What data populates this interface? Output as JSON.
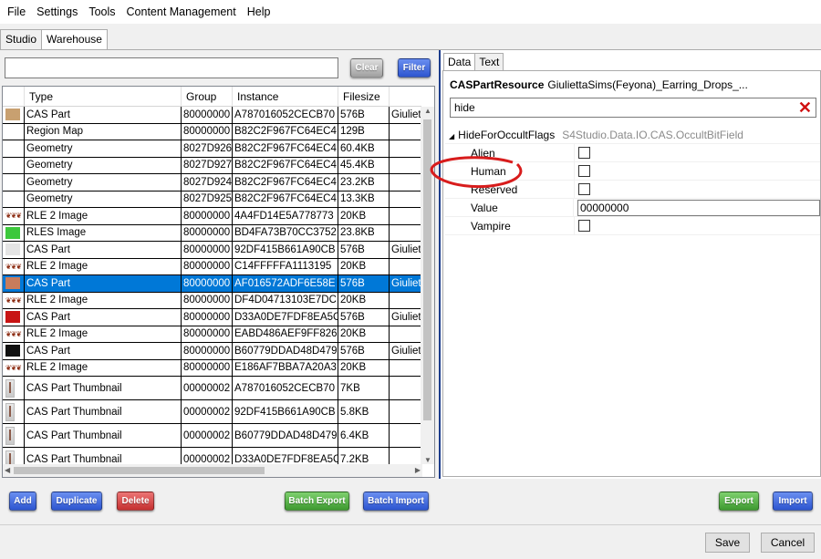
{
  "menu": [
    "File",
    "Settings",
    "Tools",
    "Content Management",
    "Help"
  ],
  "tabs": [
    "Studio",
    "Warehouse"
  ],
  "search": {
    "value": ""
  },
  "buttons": {
    "clear": "Clear",
    "filter": "Filter",
    "add": "Add",
    "duplicate": "Duplicate",
    "delete": "Delete",
    "batch_export": "Batch Export",
    "batch_import": "Batch Import",
    "export": "Export",
    "import": "Import",
    "save": "Save",
    "cancel": "Cancel"
  },
  "grid": {
    "columns": [
      "Type",
      "Group",
      "Instance",
      "Filesize"
    ],
    "rows": [
      {
        "icon": "swatch-tan",
        "type": "CAS Part",
        "group": "80000000",
        "instance": "A787016052CECB70",
        "size": "576B",
        "extra": "Giuliet"
      },
      {
        "icon": "none",
        "type": "Region Map",
        "group": "80000000",
        "instance": "B82C2F967FC64EC4",
        "size": "129B",
        "extra": ""
      },
      {
        "icon": "none",
        "type": "Geometry",
        "group": "8027D926",
        "instance": "B82C2F967FC64EC4",
        "size": "60.4KB",
        "extra": ""
      },
      {
        "icon": "none",
        "type": "Geometry",
        "group": "8027D927",
        "instance": "B82C2F967FC64EC4",
        "size": "45.4KB",
        "extra": ""
      },
      {
        "icon": "none",
        "type": "Geometry",
        "group": "8027D924",
        "instance": "B82C2F967FC64EC4",
        "size": "23.2KB",
        "extra": ""
      },
      {
        "icon": "none",
        "type": "Geometry",
        "group": "8027D925",
        "instance": "B82C2F967FC64EC4",
        "size": "13.3KB",
        "extra": ""
      },
      {
        "icon": "rle",
        "type": "RLE 2 Image",
        "group": "80000000",
        "instance": "4A4FD14E5A778773",
        "size": "20KB",
        "extra": ""
      },
      {
        "icon": "swatch-green",
        "type": "RLES Image",
        "group": "80000000",
        "instance": "BD4FA73B70CC3752",
        "size": "23.8KB",
        "extra": ""
      },
      {
        "icon": "swatch-light",
        "type": "CAS Part",
        "group": "80000000",
        "instance": "92DF415B661A90CB",
        "size": "576B",
        "extra": "Giuliet"
      },
      {
        "icon": "rle",
        "type": "RLE 2 Image",
        "group": "80000000",
        "instance": "C14FFFFFA1113195",
        "size": "20KB",
        "extra": ""
      },
      {
        "icon": "swatch-brown",
        "type": "CAS Part",
        "group": "80000000",
        "instance": "AF016572ADF6E58E",
        "size": "576B",
        "extra": "Giuliet",
        "selected": true
      },
      {
        "icon": "rle",
        "type": "RLE 2 Image",
        "group": "80000000",
        "instance": "DF4D04713103E7DC",
        "size": "20KB",
        "extra": ""
      },
      {
        "icon": "swatch-red",
        "type": "CAS Part",
        "group": "80000000",
        "instance": "D33A0DE7FDF8EA5C",
        "size": "576B",
        "extra": "Giuliet"
      },
      {
        "icon": "rle",
        "type": "RLE 2 Image",
        "group": "80000000",
        "instance": "EABD486AEF9FF826",
        "size": "20KB",
        "extra": ""
      },
      {
        "icon": "swatch-black",
        "type": "CAS Part",
        "group": "80000000",
        "instance": "B60779DDAD48D479",
        "size": "576B",
        "extra": "Giuliet"
      },
      {
        "icon": "rle",
        "type": "RLE 2 Image",
        "group": "80000000",
        "instance": "E186AF7BBA7A20A3",
        "size": "20KB",
        "extra": ""
      },
      {
        "icon": "thumb",
        "type": "CAS Part Thumbnail",
        "group": "00000002",
        "instance": "A787016052CECB70",
        "size": "7KB",
        "extra": ""
      },
      {
        "icon": "thumb",
        "type": "CAS Part Thumbnail",
        "group": "00000002",
        "instance": "92DF415B661A90CB",
        "size": "5.8KB",
        "extra": ""
      },
      {
        "icon": "thumb",
        "type": "CAS Part Thumbnail",
        "group": "00000002",
        "instance": "B60779DDAD48D479",
        "size": "6.4KB",
        "extra": ""
      },
      {
        "icon": "thumb",
        "type": "CAS Part Thumbnail",
        "group": "00000002",
        "instance": "D33A0DE7FDF8EA5C",
        "size": "7.2KB",
        "extra": ""
      }
    ]
  },
  "colors": {
    "swatch-tan": "#c8a070",
    "swatch-green": "#3cc83c",
    "swatch-light": "#e4e4e4",
    "swatch-brown": "#c87c5c",
    "swatch-red": "#c81414",
    "swatch-black": "#101010",
    "selection": "#0078d7"
  },
  "right_panel": {
    "tabs": [
      "Data",
      "Text"
    ],
    "resource_label": "CASPartResource",
    "resource_name": "GiuliettaSims(Feyona)_Earring_Drops_...",
    "search_value": "hide",
    "category_name": "HideForOccultFlags",
    "category_type": "S4Studio.Data.IO.CAS.OccultBitField",
    "props": [
      {
        "name": "Alien",
        "kind": "checkbox",
        "checked": false
      },
      {
        "name": "Human",
        "kind": "checkbox",
        "checked": false
      },
      {
        "name": "Reserved",
        "kind": "checkbox",
        "checked": false
      },
      {
        "name": "Value",
        "kind": "text",
        "value": "00000000"
      },
      {
        "name": "Vampire",
        "kind": "checkbox",
        "checked": false
      }
    ]
  }
}
